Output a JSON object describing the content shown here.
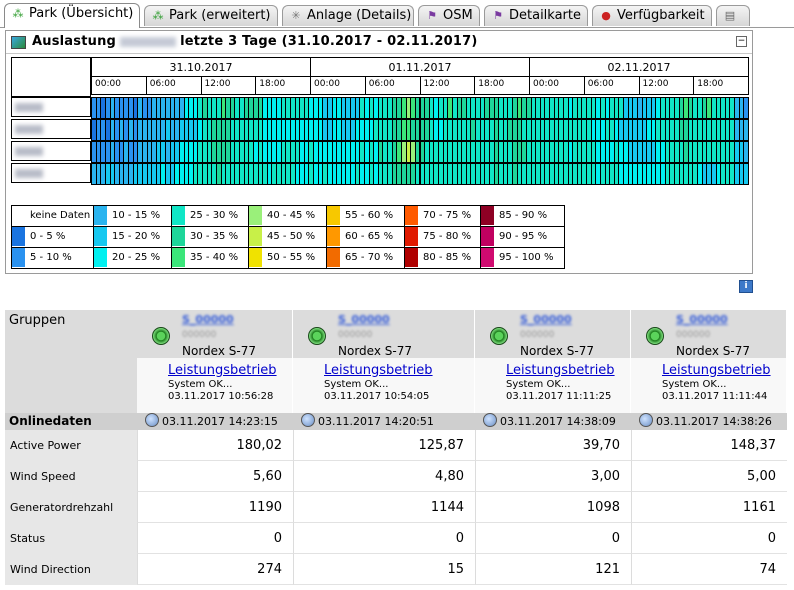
{
  "tabs": [
    {
      "label": "Park (Übersicht)",
      "icon": "park-icon",
      "active": true
    },
    {
      "label": "Park (erweitert)",
      "icon": "park-icon",
      "active": false
    },
    {
      "label": "Anlage (Details)",
      "icon": "turbine-icon",
      "active": false
    },
    {
      "label": "OSM",
      "icon": "map-icon",
      "active": false
    },
    {
      "label": "Detailkarte",
      "icon": "map-icon",
      "active": false
    },
    {
      "label": "Verfügbarkeit",
      "icon": "status-dot-icon",
      "active": false
    },
    {
      "label": "",
      "icon": "print-icon",
      "active": false
    }
  ],
  "panel": {
    "title_prefix": "Auslastung",
    "title_suffix": "letzte 3 Tage (31.10.2017 - 02.11.2017)",
    "collapse": "−"
  },
  "heatmap": {
    "dates": [
      "31.10.2017",
      "01.11.2017",
      "02.11.2017"
    ],
    "hours": [
      "00:00",
      "06:00",
      "12:00",
      "18:00"
    ],
    "levels": [
      [
        2,
        2,
        1,
        2,
        3,
        2,
        2,
        2,
        2,
        1,
        3,
        2,
        2,
        3,
        3,
        3,
        3,
        3,
        3,
        3,
        5,
        5,
        5,
        6,
        7,
        6,
        6,
        6,
        8,
        7,
        7,
        6,
        6,
        7,
        7,
        7,
        7,
        5,
        5,
        5,
        5,
        6,
        6,
        6,
        6,
        6,
        6,
        5,
        5,
        5,
        4,
        4,
        5,
        5,
        4,
        4,
        4,
        4,
        6,
        5,
        6,
        5,
        6,
        6,
        6,
        7,
        7,
        8,
        9,
        8,
        7,
        7,
        7,
        6,
        5,
        6,
        6,
        8,
        6,
        7,
        7,
        6,
        6,
        6,
        6,
        7,
        7,
        7,
        6,
        6,
        6,
        7,
        8,
        7,
        7,
        6,
        6,
        6,
        6,
        6,
        6,
        6,
        6,
        5,
        6,
        6,
        6,
        6,
        6,
        5,
        6,
        5,
        6,
        6,
        6,
        4,
        4,
        4,
        3,
        4,
        4,
        4,
        5,
        6,
        6,
        6,
        6,
        7,
        8,
        7,
        6,
        6,
        7,
        8,
        6,
        6,
        6,
        6,
        6,
        3,
        3,
        2
      ],
      [
        1,
        2,
        2,
        1,
        3,
        2,
        3,
        2,
        3,
        2,
        3,
        3,
        3,
        3,
        3,
        3,
        4,
        3,
        3,
        4,
        4,
        4,
        4,
        5,
        6,
        6,
        7,
        7,
        7,
        7,
        6,
        6,
        6,
        6,
        6,
        6,
        6,
        5,
        5,
        5,
        5,
        5,
        5,
        5,
        5,
        5,
        5,
        5,
        5,
        5,
        4,
        4,
        5,
        5,
        4,
        4,
        4,
        5,
        5,
        5,
        5,
        6,
        6,
        6,
        6,
        7,
        7,
        8,
        8,
        7,
        7,
        7,
        7,
        6,
        5,
        5,
        6,
        6,
        6,
        6,
        6,
        6,
        7,
        6,
        6,
        6,
        6,
        7,
        6,
        6,
        7,
        7,
        7,
        6,
        6,
        6,
        6,
        6,
        6,
        6,
        6,
        6,
        6,
        6,
        6,
        6,
        6,
        6,
        5,
        5,
        5,
        6,
        6,
        5,
        4,
        4,
        4,
        4,
        4,
        4,
        5,
        5,
        6,
        6,
        6,
        6,
        6,
        7,
        7,
        6,
        6,
        6,
        6,
        6,
        6,
        6,
        6,
        6,
        6,
        3,
        3,
        3
      ],
      [
        2,
        2,
        2,
        2,
        3,
        2,
        2,
        3,
        2,
        2,
        3,
        3,
        3,
        3,
        4,
        4,
        3,
        4,
        4,
        5,
        5,
        5,
        5,
        6,
        6,
        6,
        7,
        7,
        7,
        7,
        6,
        6,
        6,
        6,
        6,
        5,
        6,
        5,
        5,
        5,
        5,
        6,
        6,
        6,
        6,
        5,
        5,
        6,
        5,
        5,
        5,
        5,
        5,
        5,
        5,
        5,
        5,
        5,
        6,
        5,
        6,
        5,
        7,
        6,
        6,
        7,
        8,
        9,
        10,
        9,
        7,
        7,
        6,
        6,
        6,
        6,
        6,
        6,
        6,
        6,
        6,
        6,
        6,
        6,
        6,
        6,
        6,
        7,
        6,
        6,
        6,
        7,
        7,
        7,
        6,
        6,
        6,
        6,
        6,
        6,
        6,
        6,
        6,
        5,
        6,
        6,
        6,
        6,
        6,
        5,
        5,
        5,
        5,
        6,
        5,
        5,
        4,
        4,
        4,
        4,
        4,
        4,
        5,
        5,
        6,
        6,
        6,
        6,
        7,
        6,
        6,
        6,
        6,
        6,
        6,
        6,
        6,
        6,
        6,
        4,
        4,
        3
      ],
      [
        3,
        3,
        3,
        4,
        4,
        3,
        3,
        3,
        3,
        4,
        4,
        4,
        4,
        4,
        4,
        5,
        4,
        4,
        5,
        5,
        5,
        5,
        6,
        6,
        6,
        6,
        6,
        7,
        6,
        6,
        6,
        6,
        6,
        6,
        6,
        6,
        6,
        6,
        5,
        6,
        6,
        6,
        6,
        6,
        5,
        5,
        5,
        6,
        5,
        5,
        6,
        5,
        5,
        5,
        5,
        5,
        5,
        6,
        5,
        5,
        6,
        5,
        6,
        6,
        6,
        7,
        7,
        7,
        7,
        7,
        6,
        6,
        6,
        6,
        6,
        6,
        6,
        6,
        6,
        6,
        6,
        6,
        6,
        6,
        6,
        6,
        6,
        7,
        6,
        6,
        6,
        7,
        6,
        6,
        6,
        6,
        6,
        6,
        6,
        6,
        6,
        6,
        6,
        6,
        6,
        6,
        6,
        6,
        6,
        5,
        6,
        6,
        6,
        6,
        5,
        5,
        5,
        5,
        5,
        5,
        5,
        5,
        5,
        5,
        6,
        6,
        6,
        6,
        6,
        6,
        6,
        5,
        4,
        4,
        4,
        5,
        6,
        6,
        6,
        4,
        4,
        4
      ]
    ]
  },
  "legend": [
    {
      "label": "keine Daten",
      "color": "#ffffff"
    },
    {
      "label": "0 - 5 %",
      "color": "#1a74e0"
    },
    {
      "label": "5 - 10 %",
      "color": "#2a92f0"
    },
    {
      "label": "10 - 15 %",
      "color": "#2ab4ef"
    },
    {
      "label": "15 - 20 %",
      "color": "#16c8f0"
    },
    {
      "label": "20 - 25 %",
      "color": "#00f0f0"
    },
    {
      "label": "25 - 30 %",
      "color": "#10e6c6"
    },
    {
      "label": "30 - 35 %",
      "color": "#1ed69a"
    },
    {
      "label": "35 - 40 %",
      "color": "#3be67a"
    },
    {
      "label": "40 - 45 %",
      "color": "#9af07a"
    },
    {
      "label": "45 - 50 %",
      "color": "#c8f048"
    },
    {
      "label": "50 - 55 %",
      "color": "#f0e200"
    },
    {
      "label": "55 - 60 %",
      "color": "#f7c800"
    },
    {
      "label": "60 - 65 %",
      "color": "#ff9800"
    },
    {
      "label": "65 - 70 %",
      "color": "#f26b00"
    },
    {
      "label": "70 - 75 %",
      "color": "#ff5a00"
    },
    {
      "label": "75 - 80 %",
      "color": "#e01a00"
    },
    {
      "label": "80 - 85 %",
      "color": "#b00000"
    },
    {
      "label": "85 - 90 %",
      "color": "#8e0024"
    },
    {
      "label": "90 - 95 %",
      "color": "#c00060"
    },
    {
      "label": "95 - 100 %",
      "color": "#d00a70"
    }
  ],
  "groups_label": "Gruppen",
  "turbines": [
    {
      "model": "Nordex S-77",
      "status_link": "Leistungsbetrieb",
      "status_text": "System OK...",
      "status_time": "03.11.2017 10:56:28",
      "online_time": "03.11.2017 14:23:15",
      "active_power": "180,02",
      "wind_speed": "5,60",
      "generator_rpm": "1190",
      "status": "0",
      "wind_direction": "274"
    },
    {
      "model": "Nordex S-77",
      "status_link": "Leistungsbetrieb",
      "status_text": "System OK...",
      "status_time": "03.11.2017 10:54:05",
      "online_time": "03.11.2017 14:20:51",
      "active_power": "125,87",
      "wind_speed": "4,80",
      "generator_rpm": "1144",
      "status": "0",
      "wind_direction": "15"
    },
    {
      "model": "Nordex S-77",
      "status_link": "Leistungsbetrieb",
      "status_text": "System OK...",
      "status_time": "03.11.2017 11:11:25",
      "online_time": "03.11.2017 14:38:09",
      "active_power": "39,70",
      "wind_speed": "3,00",
      "generator_rpm": "1098",
      "status": "0",
      "wind_direction": "121"
    },
    {
      "model": "Nordex S-77",
      "status_link": "Leistungsbetrieb",
      "status_text": "System OK...",
      "status_time": "03.11.2017 11:11:44",
      "online_time": "03.11.2017 14:38:26",
      "active_power": "148,37",
      "wind_speed": "5,00",
      "generator_rpm": "1161",
      "status": "0",
      "wind_direction": "74"
    }
  ],
  "online_label": "Onlinedaten",
  "row_labels": {
    "active_power": "Active Power",
    "wind_speed": "Wind Speed",
    "generator_rpm": "Generatordrehzahl",
    "status": "Status",
    "wind_direction": "Wind Direction"
  }
}
